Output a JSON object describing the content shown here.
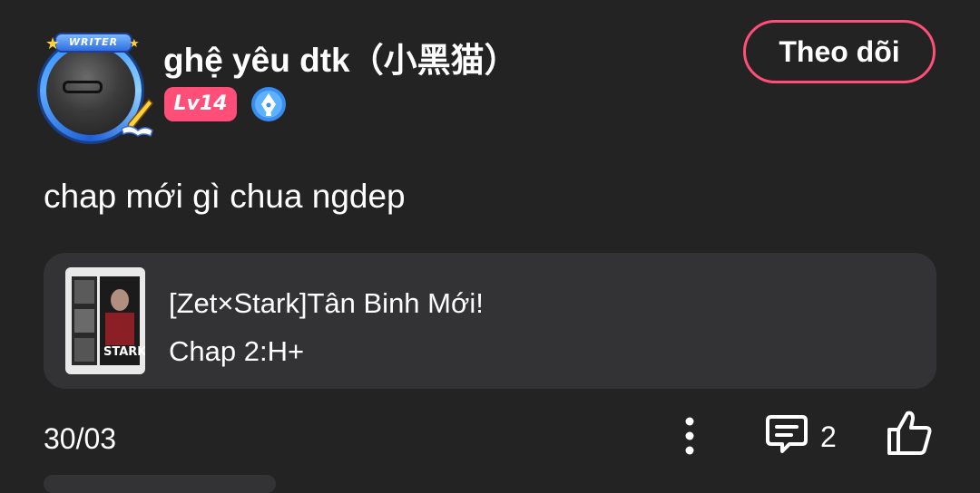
{
  "author": {
    "name": "ghệ yêu dtk（小黑猫）",
    "level": "Lv14",
    "avatar_frame_label": "WRITER",
    "avatar_icon": "writer-frame-avatar",
    "verified_icon": "pen-nib-icon"
  },
  "follow_button": {
    "label": "Theo dõi",
    "accent": "#ff4f78"
  },
  "post": {
    "text": "chap mới gì chua ngdep",
    "date": "30/03"
  },
  "story_card": {
    "title": "[Zet×Stark]Tân Binh Mới!",
    "chapter": "Chap 2:H+",
    "cover_label": "STARK"
  },
  "actions": {
    "more_icon": "vertical-dots-icon",
    "comment_icon": "comment-icon",
    "comment_count": "2",
    "like_icon": "thumbs-up-icon"
  },
  "colors": {
    "background": "#232324",
    "card": "#333335",
    "level_badge": "#ff4f78",
    "text": "#ffffff"
  }
}
